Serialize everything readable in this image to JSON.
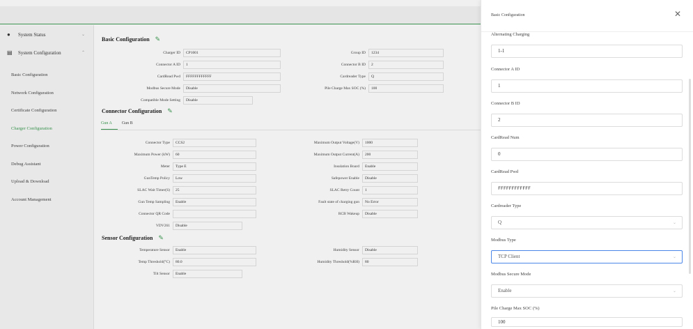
{
  "sidebar": {
    "groups": [
      {
        "label": "System Status",
        "icon": "dot-icon"
      },
      {
        "label": "System Configuration",
        "icon": "server-icon"
      }
    ],
    "items": [
      {
        "label": "Basic Configuration"
      },
      {
        "label": "Network Configuration"
      },
      {
        "label": "Certificate Configuration"
      },
      {
        "label": "Charger Configuration",
        "active": true
      },
      {
        "label": "Power Configuration"
      },
      {
        "label": "Debug Assistant"
      },
      {
        "label": "Upload & Download"
      },
      {
        "label": "Account Management"
      }
    ]
  },
  "basic": {
    "title": "Basic Configuration",
    "fields": [
      {
        "label": "Charger ID",
        "value": "CP1001"
      },
      {
        "label": "Group ID",
        "value": "1234"
      },
      {
        "label": "Connector A ID",
        "value": "1"
      },
      {
        "label": "Connector B ID",
        "value": "2"
      },
      {
        "label": "CardRead Pwd",
        "value": "FFFFFFFFFFFF"
      },
      {
        "label": "Cardreader Type",
        "value": "Q"
      },
      {
        "label": "Modbus Secure Mode",
        "value": "Disable"
      },
      {
        "label": "Pile Charge Max SOC (%)",
        "value": "100"
      },
      {
        "label": "Compatible Mode Setting",
        "value": "Disable"
      }
    ]
  },
  "connector": {
    "title": "Connector Configuration",
    "tabs": [
      "Gun A",
      "Gun B"
    ],
    "fields": [
      {
        "label": "Connector Type",
        "value": "CCS2"
      },
      {
        "label": "Maximum Output Voltage(V)",
        "value": "1000"
      },
      {
        "label": "Maximum Power (kW)",
        "value": "60"
      },
      {
        "label": "Maximum Output Current(A)",
        "value": "200"
      },
      {
        "label": "Meter",
        "value": "Type E"
      },
      {
        "label": "Insulation Board",
        "value": "Enable"
      },
      {
        "label": "GunTemp Policy",
        "value": "Low"
      },
      {
        "label": "Safepower Enable",
        "value": "Disable"
      },
      {
        "label": "SLAC Wait Timer(S)",
        "value": "25"
      },
      {
        "label": "SLAC Retry Count",
        "value": "1"
      },
      {
        "label": "Gun Temp Sampling",
        "value": "Enable"
      },
      {
        "label": "Fault state of charging gun",
        "value": "No Error"
      },
      {
        "label": "Connector QR Code",
        "value": ""
      },
      {
        "label": "RCB Wakeup",
        "value": "Disable"
      },
      {
        "label": "VDV261",
        "value": "Disable"
      }
    ]
  },
  "sensor": {
    "title": "Sensor Configuration",
    "fields": [
      {
        "label": "Temperature Sensor",
        "value": "Enable"
      },
      {
        "label": "Humidity Sensor",
        "value": "Disable"
      },
      {
        "label": "Temp Threshold(°C)",
        "value": "80.0"
      },
      {
        "label": "Humidity Threshold(%RH)",
        "value": "80"
      },
      {
        "label": "Tilt Sensor",
        "value": "Enable"
      }
    ]
  },
  "drawer": {
    "title": "Basic Configuration",
    "close_icon": "close-icon",
    "fields": [
      {
        "label": "Alternating Charging",
        "value": "1-1"
      },
      {
        "label": "Connector A ID",
        "value": "1"
      },
      {
        "label": "Connector B ID",
        "value": "2"
      },
      {
        "label": "CardRead Num",
        "value": "0"
      },
      {
        "label": "CardRead Pwd",
        "value": "FFFFFFFFFFFF"
      },
      {
        "label": "Cardreader Type",
        "value": "Q"
      },
      {
        "label": "Modbus Type",
        "value": "TCP Client"
      },
      {
        "label": "Modbus Secure Mode",
        "value": "Enable"
      },
      {
        "label": "Pile Charge Max SOC (%)",
        "value": "100"
      }
    ]
  },
  "colors": {
    "accent": "#3c9c52",
    "focus": "#4a86e8"
  }
}
